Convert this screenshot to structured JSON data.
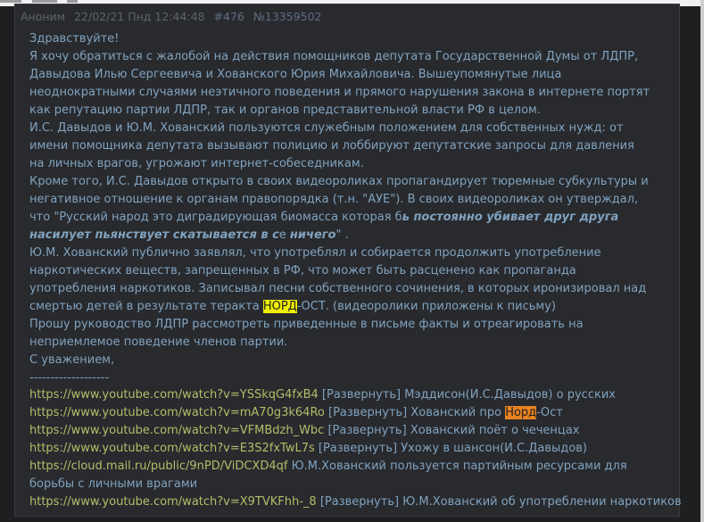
{
  "post": {
    "author": "Аноним",
    "date": "22/02/21 Пнд 12:44:48",
    "post_number": "#476",
    "post_id": "№13359502"
  },
  "message": {
    "lines": [
      "Здравствуйте!",
      "Я хочу обратиться с жалобой на действия помощников депутата Государственной Думы от ЛДПР,",
      "Давыдова Илью Сергеевича и Хованского Юрия Михайловича. Вышеупомянутые лица",
      "неоднократными случаями неэтичного поведения и прямого нарушения закона в интернете портят",
      "как репутацию партии ЛДПР, так и органов представительной власти РФ в целом.",
      "И.С. Давыдов и Ю.М. Хованский пользуются служебным положением для собственных нужд: от",
      "имени помощника депутата вызывают полицию и лоббируют депутатские запросы для давления",
      "на личных врагов, угрожают интернет-собеседникам.",
      "Кроме того, И.С. Давыдов открыто в своих видеороликах пропагандирует тюремные субкультуры и",
      "негативное отношение к органам правопорядка (т.н. \"АУЕ\"). В своих видеороликах он утверждал,"
    ],
    "quote_line1_pre": "что \"Русский народ это диградирующая биомасса которая б",
    "quote_line1_em": "ь постоянно убивает друг друга",
    "quote_line2_em1": "насилует пьянствует скатывается в с",
    "quote_line2_mid": "е ",
    "quote_line2_em2": "ничего",
    "quote_line2_post": "\" .",
    "lines2": [
      "Ю.М. Хованский публично заявлял, что употреблял и собирается продолжить употребление",
      "наркотических веществ, запрещенных в РФ, что может быть расценено как пропаганда",
      "употребления наркотиков. Записывал песни собственного сочинения, в которых иронизировал над"
    ],
    "nord_pre": "смертью детей в результате теракта ",
    "nord_hl": "НОРД",
    "nord_post": "-ОСТ. (видеоролики приложены к письму)",
    "lines3": [
      "Прошу руководство ЛДПР рассмотреть приведенные в письме факты и отреагировать на",
      "неприемлемое поведение членов партии.",
      "С уважением,"
    ],
    "separator": "-------------------"
  },
  "links": [
    {
      "url": "https://www.youtube.com/watch?v=YSSkqG4fxB4",
      "expand": "[Развернуть]",
      "desc": "Мэддисон(И.С.Давыдов) о русских"
    },
    {
      "url": "https://www.youtube.com/watch?v=mA70g3k64Ro",
      "expand": "[Развернуть]",
      "desc_pre": "Хованский про ",
      "desc_hl": "Норд",
      "desc_post": "-Ост"
    },
    {
      "url": "https://www.youtube.com/watch?v=VFMBdzh_Wbc",
      "expand": "[Развернуть]",
      "desc": "Хованский поёт о чеченцах"
    },
    {
      "url": "https://www.youtube.com/watch?v=E3S2fxTwL7s",
      "expand": "[Развернуть]",
      "desc": "Ухожу в шансон(И.С.Давыдов)"
    },
    {
      "url": "https://cloud.mail.ru/public/9nPD/ViDCXD4qf",
      "desc": "Ю.М.Хованский пользуется партийным ресурсами для"
    },
    {
      "desc": "борьбы с личными врагами"
    },
    {
      "url": "https://www.youtube.com/watch?v=X9TVKFhh-_8",
      "expand": "[Развернуть]",
      "desc": "Ю.М.Хованский об употреблении наркотиков"
    }
  ]
}
